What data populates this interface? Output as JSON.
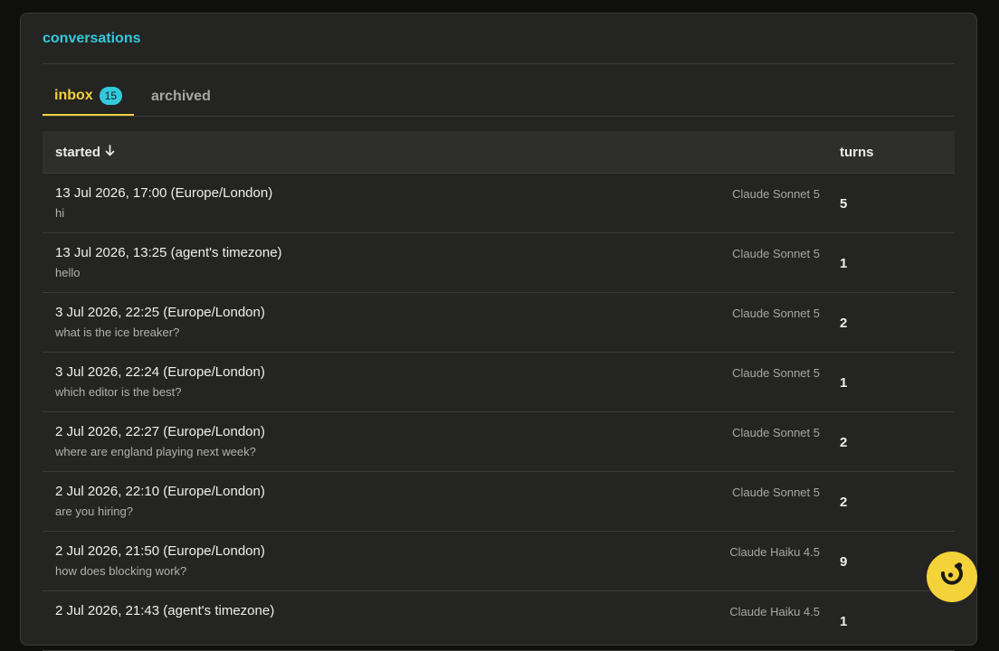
{
  "header": {
    "title": "conversations"
  },
  "tabs": [
    {
      "label": "inbox",
      "badge": "15",
      "active": true
    },
    {
      "label": "archived",
      "active": false
    }
  ],
  "table": {
    "columns": {
      "started": "started",
      "sort_icon": "arrow-down-icon",
      "turns": "turns"
    },
    "rows": [
      {
        "started": "13 Jul 2026, 17:00 (Europe/London)",
        "preview": "hi",
        "model": "Claude Sonnet 5",
        "turns": "5"
      },
      {
        "started": "13 Jul 2026, 13:25 (agent's timezone)",
        "preview": "hello",
        "model": "Claude Sonnet 5",
        "turns": "1"
      },
      {
        "started": "3 Jul 2026, 22:25 (Europe/London)",
        "preview": "what is the ice breaker?",
        "model": "Claude Sonnet 5",
        "turns": "2"
      },
      {
        "started": "3 Jul 2026, 22:24 (Europe/London)",
        "preview": "which editor is the best?",
        "model": "Claude Sonnet 5",
        "turns": "1"
      },
      {
        "started": "2 Jul 2026, 22:27 (Europe/London)",
        "preview": "where are england playing next week?",
        "model": "Claude Sonnet 5",
        "turns": "2"
      },
      {
        "started": "2 Jul 2026, 22:10 (Europe/London)",
        "preview": "are you hiring?",
        "model": "Claude Sonnet 5",
        "turns": "2"
      },
      {
        "started": "2 Jul 2026, 21:50 (Europe/London)",
        "preview": "how does blocking work?",
        "model": "Claude Haiku 4.5",
        "turns": "9"
      },
      {
        "started": "2 Jul 2026, 21:43 (agent's timezone)",
        "preview": "",
        "model": "Claude Haiku 4.5",
        "turns": "1"
      }
    ]
  },
  "fab": {
    "icon": "chat-assistant-icon"
  },
  "colors": {
    "accent_cyan": "#33c9dc",
    "accent_yellow": "#f3d23a",
    "panel_bg": "#242422",
    "page_bg": "#0f0f0e"
  }
}
